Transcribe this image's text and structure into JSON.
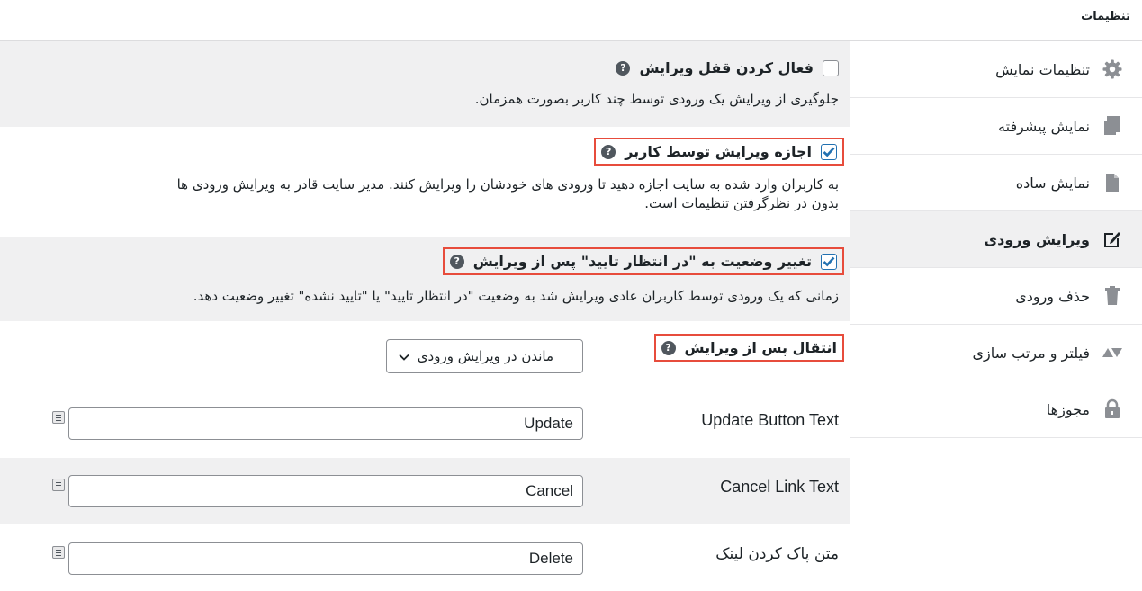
{
  "header": {
    "title": "تنظیمات"
  },
  "sidebar": {
    "items": [
      {
        "label": "تنظیمات نمایش",
        "icon": "gear-icon"
      },
      {
        "label": "نمایش پیشرفته",
        "icon": "copy-icon"
      },
      {
        "label": "نمایش ساده",
        "icon": "document-icon"
      },
      {
        "label": "ویرایش ورودی",
        "icon": "edit-icon"
      },
      {
        "label": "حذف ورودی",
        "icon": "trash-icon"
      },
      {
        "label": "فیلتر و مرتب سازی",
        "icon": "triangles-icon"
      },
      {
        "label": "مجوزها",
        "icon": "lock-icon"
      }
    ],
    "active_index": 3
  },
  "settings": {
    "edit_lock": {
      "label": "فعال کردن قفل ویرایش",
      "description": "جلوگیری از ویرایش یک ورودی توسط چند کاربر بصورت همزمان.",
      "checked": false
    },
    "user_edit": {
      "label": "اجازه ویرایش توسط کاربر",
      "description_line1": "به کاربران وارد شده به سایت اجازه دهید تا ورودی های خودشان را ویرایش کنند. مدیر سایت قادر به ویرایش ورودی ها",
      "description_line2": "بدون در نظرگرفتن تنظیمات است.",
      "checked": true
    },
    "pending_status": {
      "label": "تغییر وضعیت به \"در انتظار تایید\" پس از ویرایش",
      "description": "زمانی که یک ورودی توسط کاربران عادی ویرایش شد به وضعیت \"در انتظار تایید\" یا \"تایید نشده\" تغییر وضعیت دهد.",
      "checked": true
    },
    "redirect": {
      "label": "انتقال پس از ویرایش",
      "selected": "ماندن در ویرایش ورودی"
    },
    "update_button": {
      "label": "Update Button Text",
      "value": "Update"
    },
    "cancel_link": {
      "label": "Cancel Link Text",
      "value": "Cancel"
    },
    "delete_link": {
      "label": "متن پاک کردن لینک",
      "value": "Delete"
    }
  },
  "colors": {
    "highlight": "#e74c3c",
    "accent": "#2271b1",
    "row_gray": "#f0f0f1"
  },
  "help_glyph": "?"
}
